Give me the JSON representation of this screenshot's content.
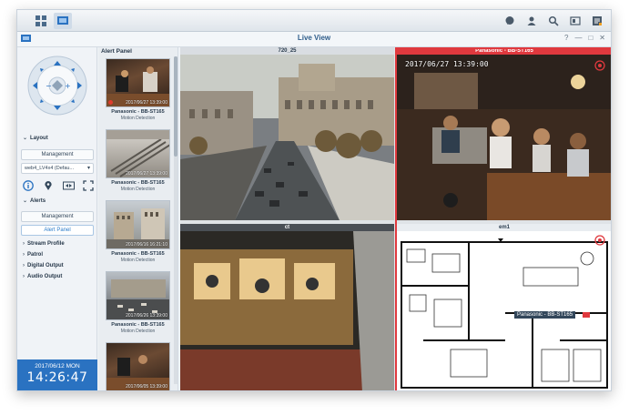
{
  "window": {
    "title": "Live View"
  },
  "titlebar_controls": [
    "?",
    "—",
    "□",
    "✕"
  ],
  "sidebar": {
    "layout_header": "Layout",
    "management_button": "Management",
    "layout_select": "web4_LV4x4 (Defau...",
    "alerts_header": "Alerts",
    "alerts_management_button": "Management",
    "alert_panel_button": "Alert Panel",
    "sections": [
      "Stream Profile",
      "Patrol",
      "Digital Output",
      "Audio Output"
    ]
  },
  "clock": {
    "date": "2017/06/12  MON",
    "time": "14:26:47"
  },
  "alert_panel": {
    "title": "Alert Panel",
    "items": [
      {
        "timestamp": "2017/06/27 13:39:00",
        "camera": "Panasonic - BB-ST165",
        "event": "Motion Detection"
      },
      {
        "timestamp": "2017/06/27 13:39:00",
        "camera": "Panasonic - BB-ST165",
        "event": "Motion Detection"
      },
      {
        "timestamp": "2017/06/16 16:21:10",
        "camera": "Panasonic - BB-ST165",
        "event": "Motion Detection"
      },
      {
        "timestamp": "2017/06/26 13:39:00",
        "camera": "Panasonic - BB-ST165",
        "event": "Motion Detection"
      },
      {
        "timestamp": "2017/06/05 13:39:00",
        "camera": "",
        "event": ""
      }
    ]
  },
  "tiles": [
    {
      "name": "720_25"
    },
    {
      "name": "Panasonic - BB-ST165",
      "overlay": "2017/06/27    13:39:00"
    },
    {
      "name": "ct"
    },
    {
      "name": "em1",
      "tag": "Panasonic - BB-ST165"
    }
  ]
}
